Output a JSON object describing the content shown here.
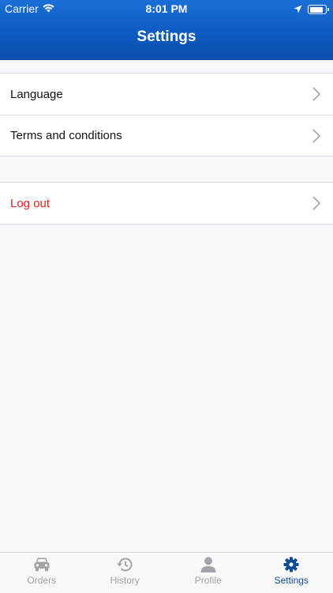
{
  "status_bar": {
    "carrier": "Carrier",
    "time": "8:01 PM",
    "battery_level": 0.85
  },
  "header": {
    "title": "Settings"
  },
  "settings_groups": [
    {
      "items": [
        {
          "label": "Language"
        },
        {
          "label": "Terms and conditions"
        }
      ]
    },
    {
      "items": [
        {
          "label": "Log out"
        }
      ]
    }
  ],
  "tabbar": {
    "items": [
      {
        "label": "Orders",
        "icon": "car-icon"
      },
      {
        "label": "History",
        "icon": "history-icon"
      },
      {
        "label": "Profile",
        "icon": "person-icon"
      },
      {
        "label": "Settings",
        "icon": "gear-icon"
      }
    ],
    "active_index": 3
  },
  "colors": {
    "header": "#0d5bc4",
    "danger": "#e0231f",
    "tab_active": "#0e4a95",
    "tab_inactive": "#a3a3a8"
  }
}
